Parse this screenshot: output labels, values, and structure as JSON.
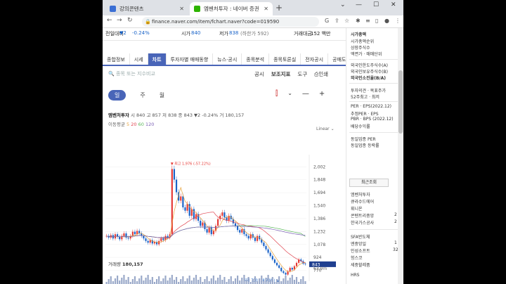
{
  "browser": {
    "tabs": [
      {
        "title": "강의콘텐츠",
        "favicon_color": "#3b6fd4",
        "active": false
      },
      {
        "title": "엠벤처투자 : 네이버 증권",
        "favicon_color": "#2db400",
        "active": true
      }
    ],
    "new_tab": "+",
    "url": "finance.naver.com/item/fchart.naver?code=019590",
    "window_controls": [
      "⌄",
      "—",
      "☐",
      "✕"
    ]
  },
  "quote": {
    "change_label": "전일대비",
    "change_value": "▼2",
    "change_pct": "-0.24%",
    "cap_label": "시가",
    "cap_value": "840",
    "low_label": "저가",
    "low_value": "838",
    "low_limit": "(하한가 592)",
    "amount_label": "거래대금",
    "amount_value": "152 백만"
  },
  "menu": {
    "items": [
      "종합정보",
      "시세",
      "차트",
      "투자자별 매매동향",
      "뉴스·공시",
      "종목분석",
      "종목토론실",
      "전자공시",
      "공매도현황"
    ],
    "active_index": 2
  },
  "compare_placeholder": "종목 또는 지수비교",
  "tools": [
    "공시",
    "보조지표",
    "도구",
    "인쇄"
  ],
  "periods": [
    "일",
    "주",
    "월"
  ],
  "selected_period": "일",
  "chart_header": {
    "name": "엠벤처투자",
    "ohlc_text": "시 840  고 857  저 838  종 843  ▼2  -0.24%  거 180,157",
    "ma_label": "이동평균",
    "ma_values": [
      "5",
      "20",
      "60",
      "120"
    ],
    "ma_colors": [
      "#e8a33d",
      "#e0444f",
      "#5cb85c",
      "#7a5fb5"
    ],
    "scale": "Linear"
  },
  "chart_data": {
    "type": "candlestick",
    "y_ticks": [
      2002,
      1848,
      1694,
      1540,
      1386,
      1232,
      1078,
      924,
      770
    ],
    "ylim": [
      700,
      2080
    ],
    "current_price": 843,
    "max_annotation": "최고 1,976 (-57.22%)",
    "min_annotation": "최저 710 (18.73%)",
    "series": [
      {
        "name": "close",
        "values": [
          1180,
          1160,
          1190,
          1150,
          1200,
          1170,
          1140,
          1180,
          1210,
          1160,
          1150,
          1180,
          1230,
          1200,
          1240,
          1210,
          1180,
          1150,
          1120,
          1100,
          1130,
          1090,
          1110,
          1080,
          1120,
          1150,
          1130,
          1180,
          1160,
          1200,
          1976,
          1850,
          1700,
          1600,
          1650,
          1520,
          1480,
          1560,
          1420,
          1500,
          1380,
          1440,
          1360,
          1300,
          1340,
          1260,
          1220,
          1280,
          1200,
          1240,
          1300,
          1380,
          1420,
          1460,
          1400,
          1360,
          1420,
          1380,
          1330,
          1300,
          1250,
          1220,
          1260,
          1200,
          1180,
          1150,
          1200,
          1160,
          1120,
          1180,
          1140,
          1100,
          1060,
          1020,
          980,
          940,
          900,
          860,
          830,
          800,
          760,
          740,
          720,
          760,
          800,
          780,
          820,
          860,
          900,
          880,
          850,
          843
        ]
      }
    ],
    "volume_max": "63.9m"
  },
  "volume": {
    "label": "거래량",
    "value": "180,157"
  },
  "sidebar": {
    "items": [
      "시가총액",
      "시가총액순위",
      "상장주식수",
      "액면가 · 매매단위",
      "외국인한도주식수(A)",
      "외국인보유주식수(B)",
      "외국인소진율(B/A)",
      "투자의견 · 목표주가",
      "52주최고 · 최저",
      "PER · EPS(2022.12)",
      "추정PER · EPS",
      "PBR · BPS (2022.12)",
      "배당수익률",
      "동일업종 PER",
      "동일업종 등락률"
    ],
    "button": "최근조회",
    "recent": [
      "엠벤처투자",
      "큐라수드에어",
      "휘니온",
      "콘텐트리중앙",
      "한국가스공사"
    ],
    "recent_values": [
      "",
      "",
      "",
      "2",
      "2"
    ],
    "lower": [
      "SFA반도체",
      "엔중앙일",
      "인성소프트",
      "헝스코",
      "세중할레품",
      "HRS"
    ],
    "lower_values": [
      "",
      "1",
      "32",
      "",
      "",
      ""
    ]
  }
}
